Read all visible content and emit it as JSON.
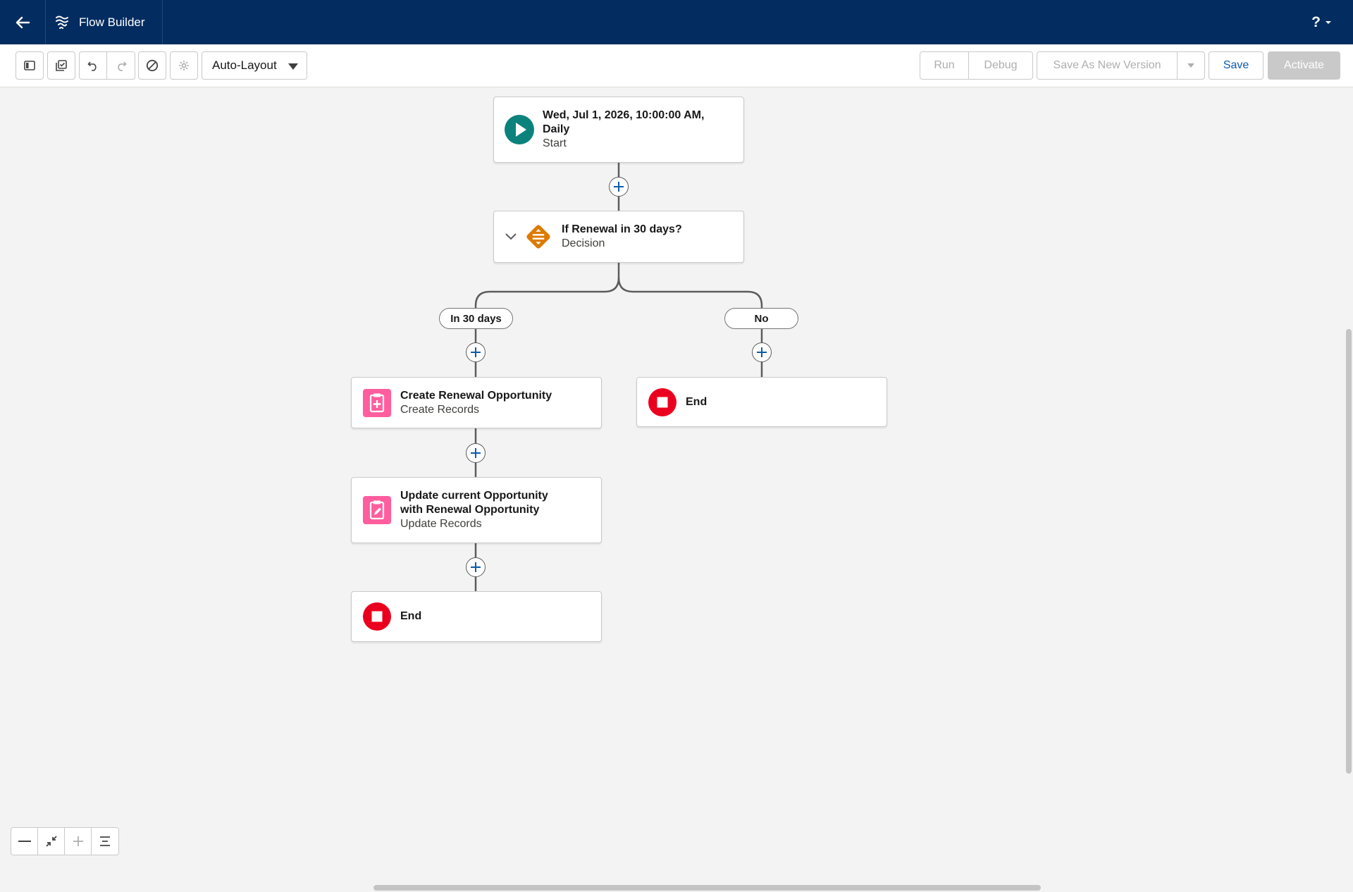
{
  "header": {
    "app_title": "Flow Builder",
    "help_label": "?",
    "icons": {
      "back": "back-arrow-icon",
      "app": "flow-icon",
      "help_caret": "chevron-down-icon"
    }
  },
  "toolbar": {
    "icon_buttons": [
      "toggle-panel-icon",
      "save-copy-icon",
      "undo-icon",
      "redo-icon",
      "block-icon",
      "gear-icon"
    ],
    "layout_select": {
      "selected": "Auto-Layout"
    },
    "run_label": "Run",
    "debug_label": "Debug",
    "save_as_new_version_label": "Save As New Version",
    "save_label": "Save",
    "activate_label": "Activate"
  },
  "flow": {
    "start": {
      "title_line1": "Wed, Jul 1, 2026, 10:00:00 AM,",
      "title_line2": "Daily",
      "subtitle": "Start"
    },
    "decision": {
      "title": "If Renewal in 30 days?",
      "subtitle": "Decision"
    },
    "branches": [
      "In 30 days",
      "No"
    ],
    "create": {
      "title": "Create Renewal Opportunity",
      "subtitle": "Create Records"
    },
    "update": {
      "title_line1": "Update current Opportunity",
      "title_line2": "with Renewal Opportunity",
      "subtitle": "Update Records"
    },
    "end_left": {
      "title": "End"
    },
    "end_right": {
      "title": "End"
    }
  },
  "colors": {
    "header_bg": "#032d60",
    "start_icon": "#0b827c",
    "decision_icon": "#dd7a01",
    "record_icon": "#ff5d9e",
    "end_icon": "#ea001e",
    "save_text": "#0b5cab"
  }
}
